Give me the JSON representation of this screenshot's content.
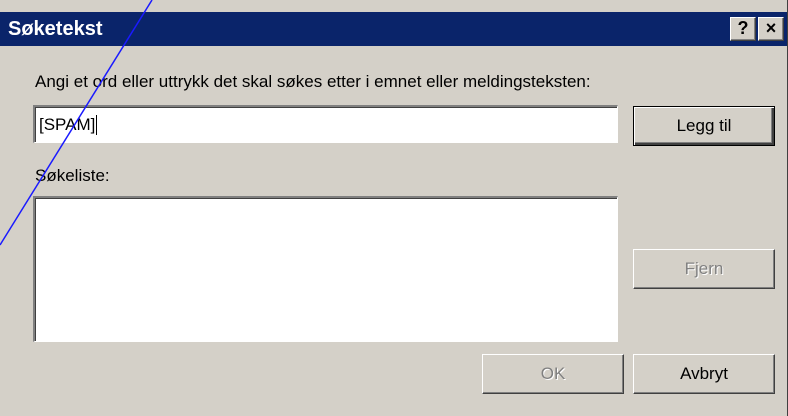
{
  "window": {
    "title": "Søketekst",
    "help_glyph": "?",
    "close_glyph": "×"
  },
  "form": {
    "prompt_label": "Angi et ord eller uttrykk det skal søkes etter i emnet eller meldingsteksten:",
    "search_value": "[SPAM]",
    "list_label": "Søkeliste:",
    "list_items": []
  },
  "buttons": {
    "add": "Legg til",
    "remove": "Fjern",
    "ok": "OK",
    "cancel": "Avbryt"
  }
}
